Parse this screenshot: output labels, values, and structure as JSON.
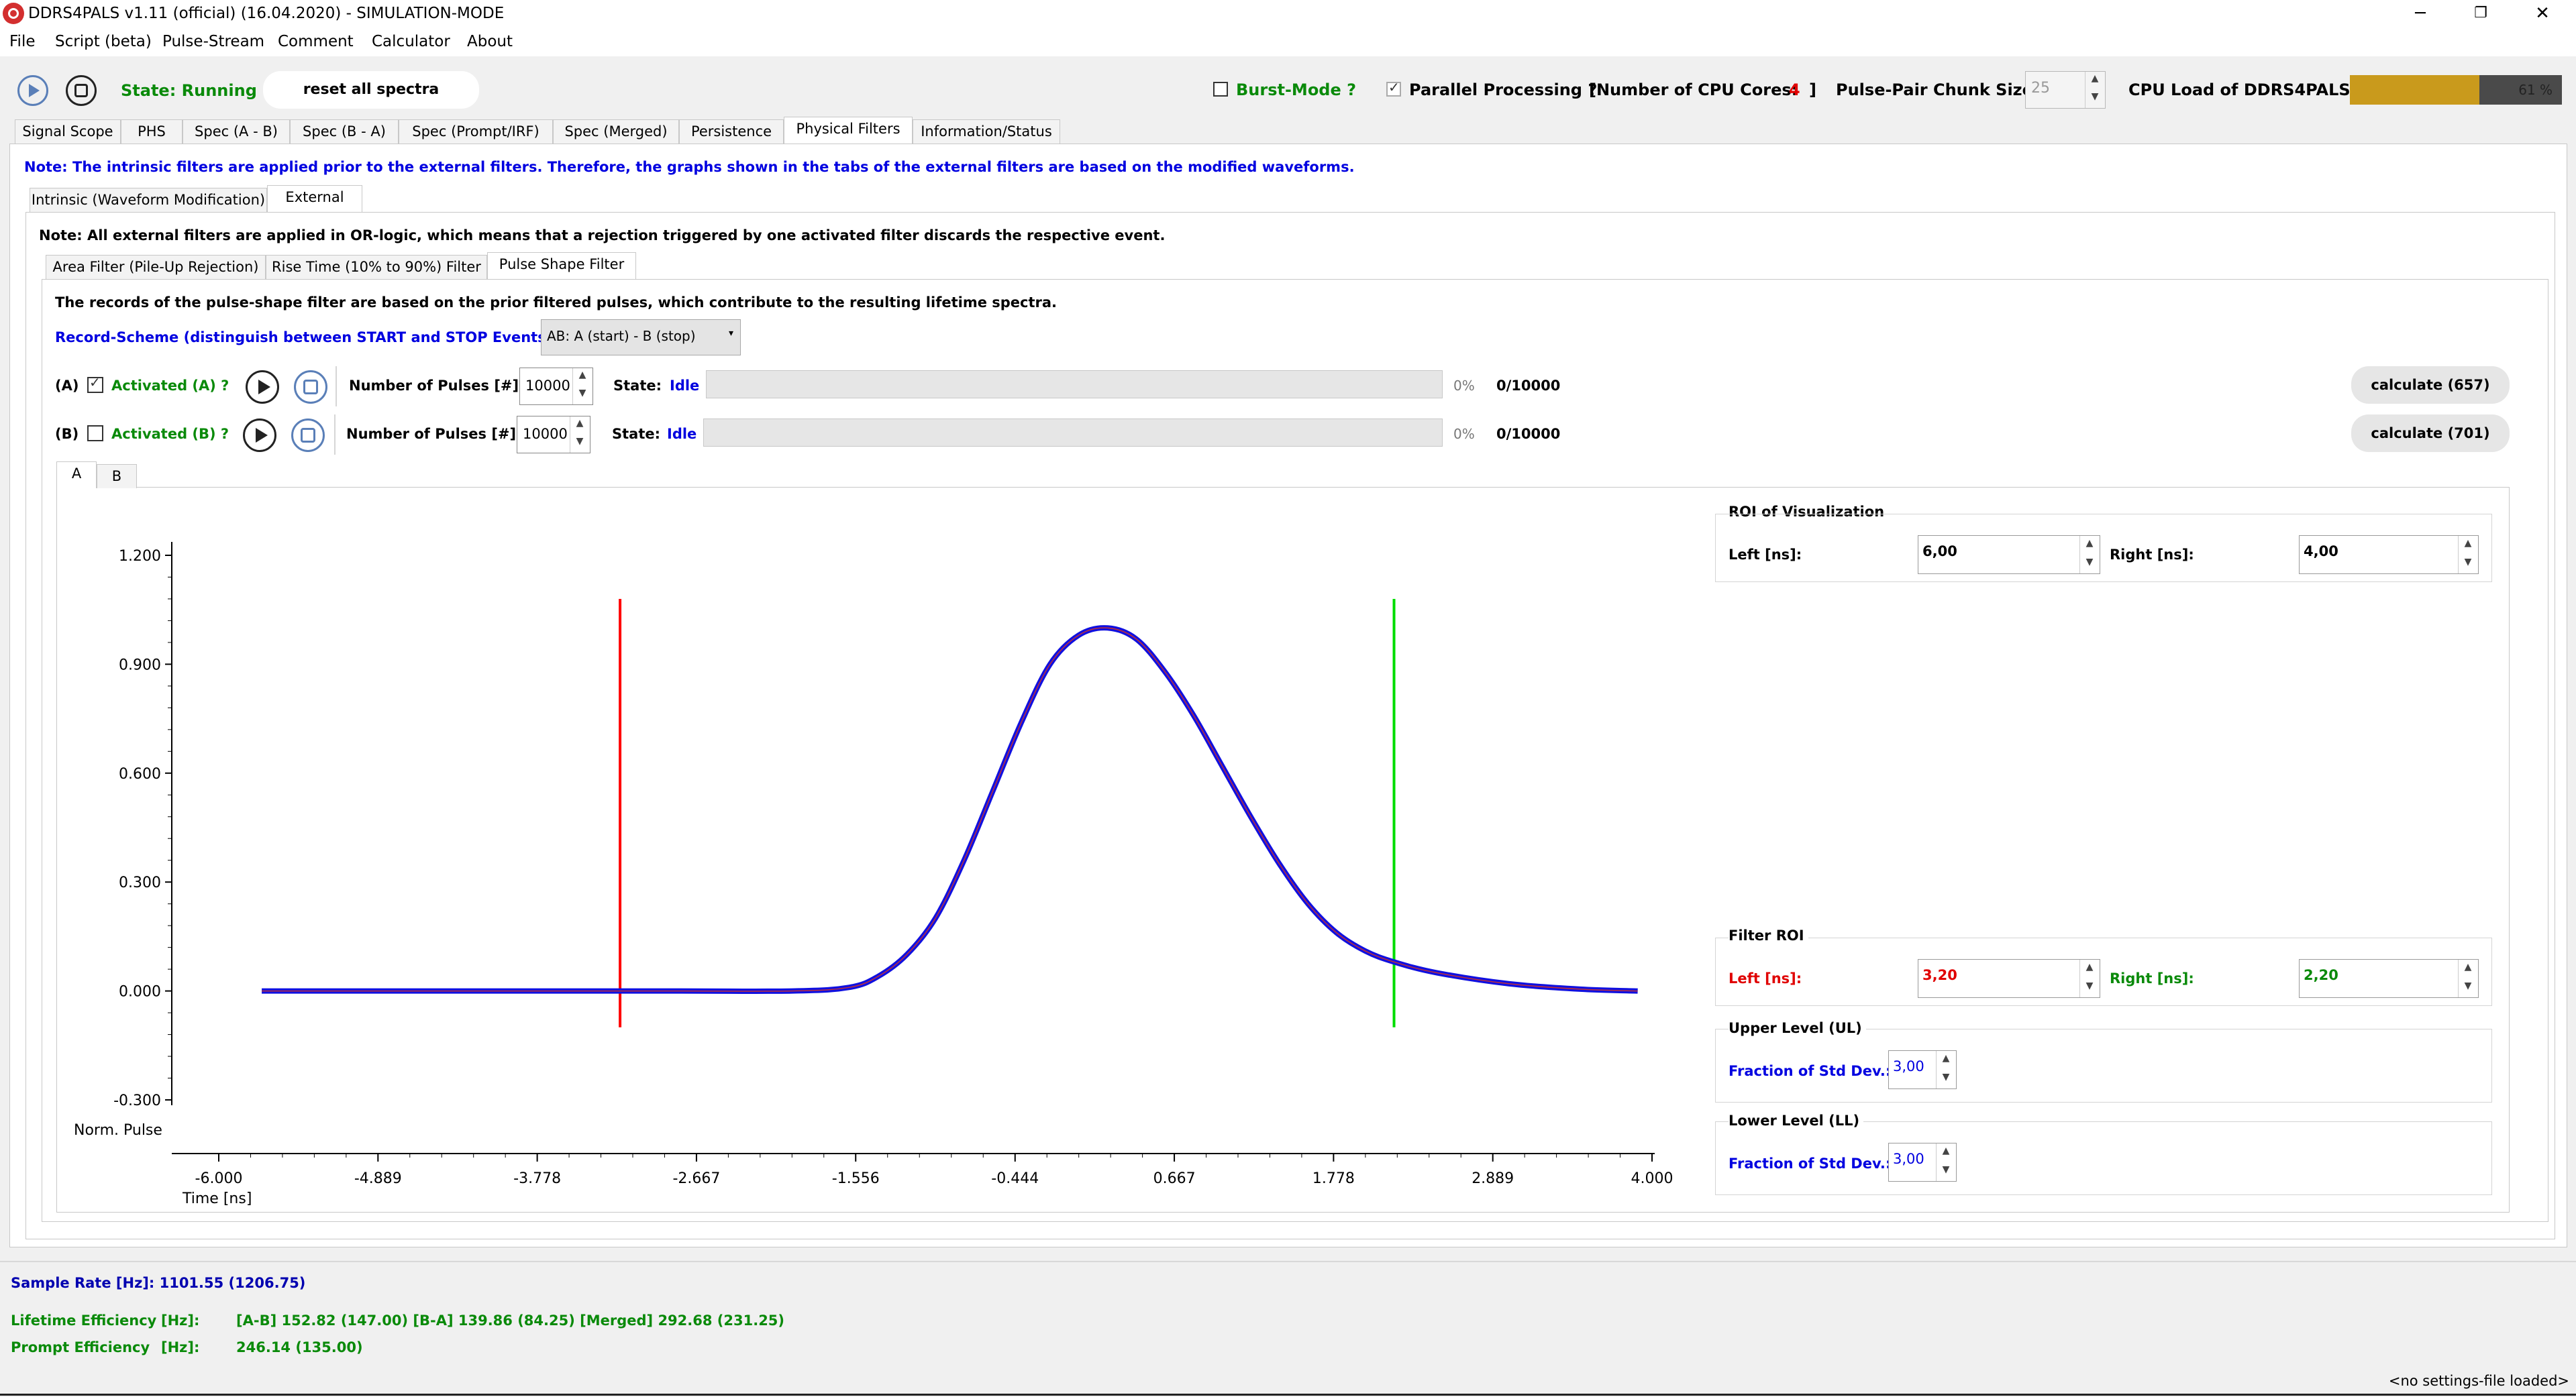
{
  "window": {
    "title": "DDRS4PALS v1.11 (official) (16.04.2020) - SIMULATION-MODE",
    "minimize": "─",
    "restore": "❐",
    "close": "✕"
  },
  "menu": [
    "File",
    "Script (beta)",
    "Pulse-Stream",
    "Comment",
    "Calculator",
    "About"
  ],
  "toolbar": {
    "state_label": "State: Running",
    "reset_label": "reset all spectra",
    "burst_label": "Burst-Mode ?",
    "parallel_label": "Parallel Processing ?",
    "cpu_cores_label": "[Number of CPU Cores:",
    "cpu_cores_value": "4",
    "cpu_cores_close": "]",
    "chunk_label": "Pulse-Pair Chunk Size:",
    "chunk_value": "25",
    "cpu_load_label": "CPU Load of DDRS4PALS:",
    "cpu_load_value": "61 %",
    "cpu_load_fraction": 0.61
  },
  "main_tabs": [
    "Signal Scope",
    "PHS",
    "Spec (A - B)",
    "Spec (B - A)",
    "Spec (Prompt/IRF)",
    "Spec (Merged)",
    "Persistence",
    "Physical Filters",
    "Information/Status"
  ],
  "note_intrinsic": "Note: The intrinsic filters are applied prior to the external filters. Therefore, the graphs shown in the tabs of the external filters are based on the modified waveforms.",
  "filter_tabs": [
    "Intrinsic (Waveform Modification)",
    "External"
  ],
  "note_external": "Note: All external filters are applied in OR-logic, which means that a rejection triggered by one activated filter discards the respective event.",
  "external_tabs": [
    "Area Filter (Pile-Up Rejection)",
    "Rise Time (10% to 90%) Filter",
    "Pulse Shape Filter"
  ],
  "pulse_shape": {
    "info": "The records of the pulse-shape filter are based on the prior filtered pulses, which contribute to the resulting lifetime spectra.",
    "record_scheme_label": "Record-Scheme (distinguish between START and STOP Events):",
    "record_scheme_value": "AB: A (start) - B (stop)",
    "rows": [
      {
        "prefix": "(A)",
        "activated_label": "Activated (A) ?",
        "pulses_label": "Number of Pulses [#]:",
        "pulses_value": "10000",
        "state_label": "State:",
        "state_value": "Idle",
        "percent": "0%",
        "count": "0/10000",
        "calc_label": "calculate (657)"
      },
      {
        "prefix": "(B)",
        "activated_label": "Activated (B) ?",
        "pulses_label": "Number of Pulses [#]:",
        "pulses_value": "10000",
        "state_label": "State:",
        "state_value": "Idle",
        "percent": "0%",
        "count": "0/10000",
        "calc_label": "calculate (701)"
      }
    ],
    "plot_tabs": [
      "A",
      "B"
    ]
  },
  "chart_data": {
    "type": "line",
    "xlabel": "Time [ns]",
    "ylabel": "Norm. Pulse",
    "xlim": [
      -6.0,
      4.0
    ],
    "ylim": [
      -0.3,
      1.2
    ],
    "x_ticks": [
      "-6.000",
      "-4.889",
      "-3.778",
      "-2.667",
      "-1.556",
      "-0.444",
      "0.667",
      "1.778",
      "2.889",
      "4.000"
    ],
    "y_ticks": [
      "1.200",
      "0.900",
      "0.600",
      "0.300",
      "0.000",
      "-0.300"
    ],
    "series": [
      {
        "color": "#1010e0",
        "x": [
          -5.7,
          -3.0,
          -2.0,
          -1.6,
          -1.4,
          -1.2,
          -1.0,
          -0.8,
          -0.6,
          -0.4,
          -0.2,
          0.0,
          0.2,
          0.4,
          0.6,
          0.8,
          1.0,
          1.2,
          1.4,
          1.6,
          1.8,
          2.0,
          2.2,
          2.5,
          3.0,
          3.5,
          3.9
        ],
        "y": [
          0.0,
          0.0,
          0.0,
          0.01,
          0.04,
          0.1,
          0.2,
          0.36,
          0.55,
          0.74,
          0.9,
          0.98,
          1.0,
          0.97,
          0.88,
          0.76,
          0.62,
          0.48,
          0.35,
          0.24,
          0.16,
          0.11,
          0.08,
          0.05,
          0.02,
          0.005,
          0.0
        ]
      }
    ],
    "markers": [
      {
        "x": -3.2,
        "color": "#ff0000"
      },
      {
        "x": 2.2,
        "color": "#00dd00"
      }
    ]
  },
  "roi_visualization": {
    "title": "ROI of Visualization",
    "left_label": "Left [ns]:",
    "left_value": "6,00",
    "right_label": "Right [ns]:",
    "right_value": "4,00"
  },
  "filter_roi": {
    "title": "Filter ROI",
    "left_label": "Left [ns]:",
    "left_value": "3,20",
    "right_label": "Right [ns]:",
    "right_value": "2,20"
  },
  "upper_level": {
    "title": "Upper Level (UL)",
    "label": "Fraction of Std Dev.:",
    "value": "3,00"
  },
  "lower_level": {
    "title": "Lower Level (LL)",
    "label": "Fraction of Std Dev.:",
    "value": "3,00"
  },
  "status": {
    "sample_rate": "Sample Rate [Hz]: 1101.55 (1206.75)",
    "lifetime_label": "Lifetime Efficiency",
    "lifetime_unit": "[Hz]:",
    "lifetime_value": "[A-B] 152.82 (147.00) [B-A] 139.86 (84.25) [Merged] 292.68 (231.25)",
    "prompt_label": "Prompt Efficiency",
    "prompt_unit": "[Hz]:",
    "prompt_value": "246.14 (135.00)",
    "settings_file": "<no settings-file loaded>"
  }
}
